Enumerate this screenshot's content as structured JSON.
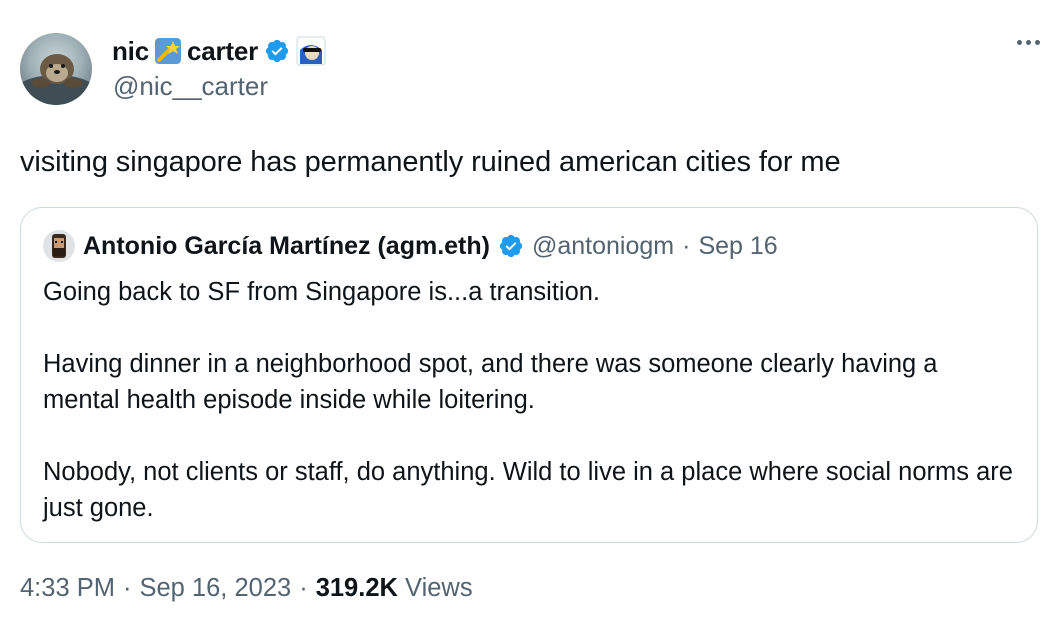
{
  "author": {
    "name_first": "nic",
    "name_last": "carter",
    "handle": "@nic__carter",
    "avatar_icon": "otter-avatar",
    "name_emoji_icon": "shooting-star-icon",
    "verified_icon": "verified-badge-icon",
    "affiliation_icon": "sunglasses-badge-icon"
  },
  "tweet": {
    "text": "visiting singapore has permanently ruined american cities for me"
  },
  "quoted_tweet": {
    "author_name": "Antonio García Martínez (agm.eth)",
    "handle": "@antoniogm",
    "separator": "·",
    "date": "Sep 16",
    "paragraphs": [
      "Going back to SF from Singapore is...a transition.",
      "Having dinner in a neighborhood spot, and there was someone clearly having a mental health episode inside while loitering.",
      "Nobody, not clients or staff, do anything. Wild to live in a place where social norms are just gone."
    ]
  },
  "meta": {
    "time": "4:33 PM",
    "sep1": "·",
    "date": "Sep 16, 2023",
    "sep2": "·",
    "views_count": "319.2K",
    "views_label": "Views"
  },
  "colors": {
    "text_primary": "#0f1419",
    "text_secondary": "#536471",
    "verified_blue": "#1d9bf0",
    "border": "#cfd9de"
  }
}
